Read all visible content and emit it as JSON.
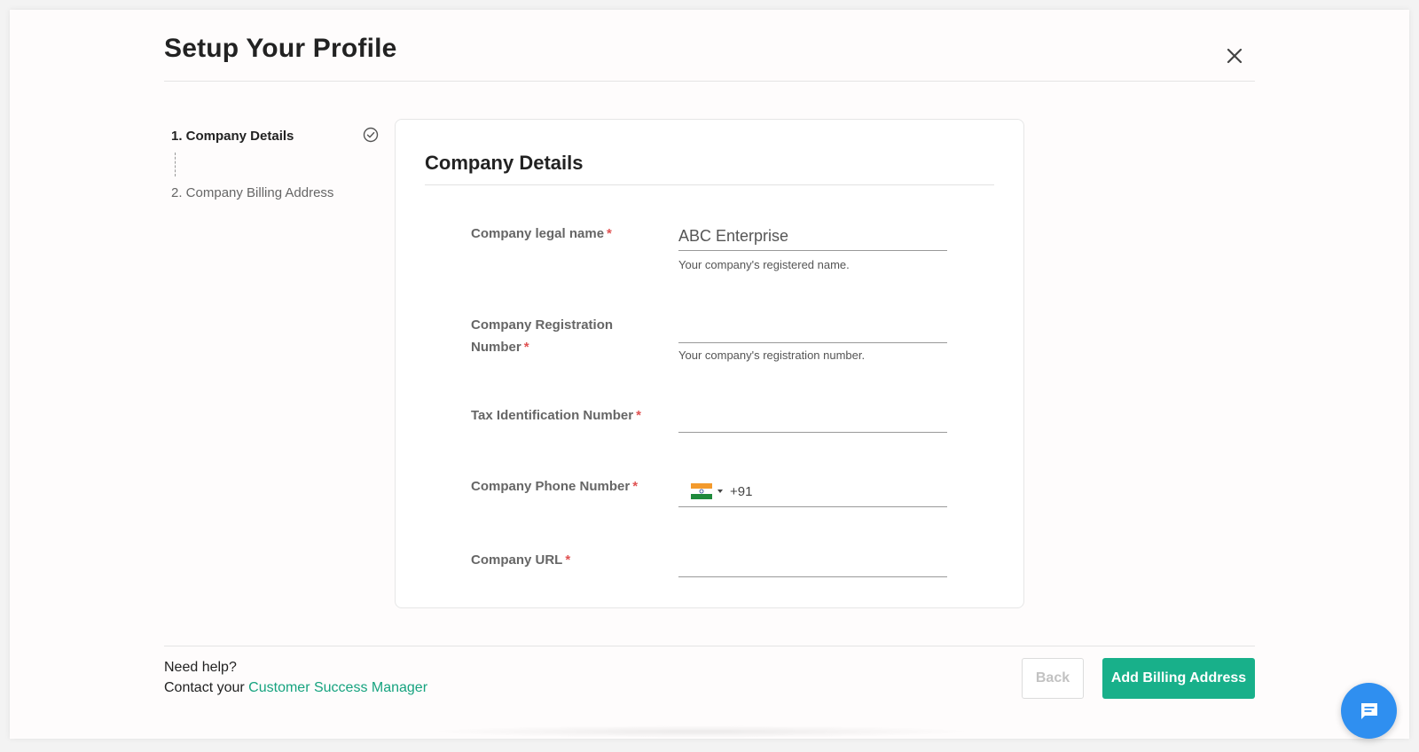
{
  "header": {
    "title": "Setup Your Profile"
  },
  "stepper": {
    "steps": [
      {
        "label": "1. Company Details",
        "state": "active-completed"
      },
      {
        "label": "2. Company Billing Address",
        "state": "pending"
      }
    ]
  },
  "card": {
    "title": "Company Details"
  },
  "form": {
    "required_marker": "*",
    "legal_name": {
      "label": "Company legal name",
      "value": "ABC Enterprise",
      "help": "Your company's registered name."
    },
    "registration_number": {
      "label": "Company Registration Number",
      "value": "",
      "help": "Your company's registration number."
    },
    "tax_id": {
      "label": "Tax Identification Number",
      "value": ""
    },
    "phone": {
      "label": "Company Phone Number",
      "country": "India",
      "value": "+91"
    },
    "url": {
      "label": "Company URL",
      "value": ""
    }
  },
  "footer": {
    "help_title": "Need help?",
    "help_prefix": "Contact your",
    "help_link": "Customer Success Manager",
    "back_label": "Back",
    "primary_label": "Add Billing Address"
  },
  "colors": {
    "primary": "#18b08a",
    "link": "#16a37f",
    "required": "#e05252",
    "chat_fab": "#2f8ff0"
  },
  "icons": {
    "close": "close-icon",
    "step_done": "check-circle-icon",
    "chat": "chat-icon",
    "flag": "india-flag-icon"
  }
}
